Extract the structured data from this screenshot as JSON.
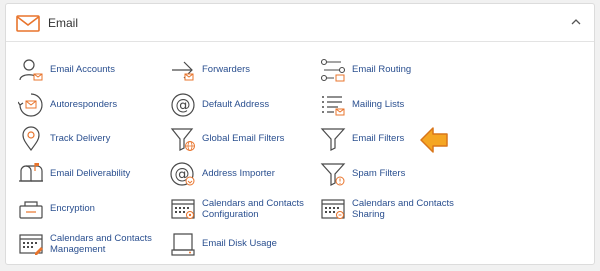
{
  "section": {
    "title": "Email",
    "header_icon": "envelope-icon",
    "collapse_icon": "chevron-up-icon"
  },
  "colors": {
    "label": "#2a4f8f",
    "icon_stroke": "#4a4a4a",
    "icon_accent": "#e8742c",
    "pointer_fill": "#f5a623",
    "pointer_stroke": "#d9761a"
  },
  "items": [
    {
      "label": "Email Accounts",
      "icon": "user-mail-icon"
    },
    {
      "label": "Forwarders",
      "icon": "forwarder-arrow-icon"
    },
    {
      "label": "Email Routing",
      "icon": "routing-icon"
    },
    {
      "label": "Autoresponders",
      "icon": "autoresponder-icon"
    },
    {
      "label": "Default Address",
      "icon": "at-sign-icon"
    },
    {
      "label": "Mailing Lists",
      "icon": "list-icon"
    },
    {
      "label": "Track Delivery",
      "icon": "location-pin-icon"
    },
    {
      "label": "Global Email Filters",
      "icon": "global-filter-icon"
    },
    {
      "label": "Email Filters",
      "icon": "filter-icon"
    },
    {
      "label": "Email Deliverability",
      "icon": "mailbox-icon"
    },
    {
      "label": "Address Importer",
      "icon": "at-import-icon"
    },
    {
      "label": "Spam Filters",
      "icon": "spam-filter-icon"
    },
    {
      "label": "Encryption",
      "icon": "key-box-icon"
    },
    {
      "label": "Calendars and Contacts Configuration",
      "icon": "calendar-config-icon"
    },
    {
      "label": "Calendars and Contacts Sharing",
      "icon": "calendar-share-icon"
    },
    {
      "label": "Calendars and Contacts Management",
      "icon": "calendar-manage-icon"
    },
    {
      "label": "Email Disk Usage",
      "icon": "disk-icon"
    }
  ],
  "pointer": {
    "icon": "pointer-arrow-icon",
    "target": "Email Filters"
  }
}
